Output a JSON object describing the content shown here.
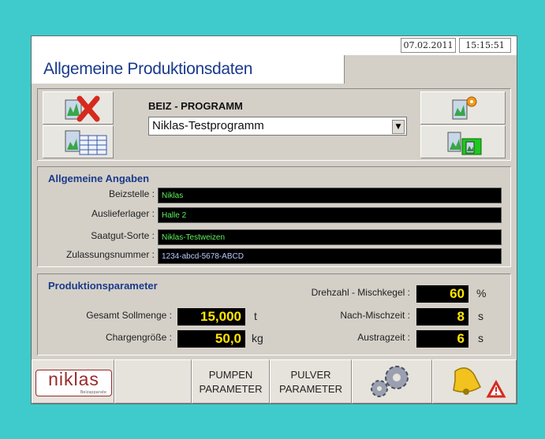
{
  "header": {
    "date": "07.02.2011",
    "time": "15:15:51"
  },
  "title": "Allgemeine Produktionsdaten",
  "program": {
    "label": "BEIZ - PROGRAMM",
    "selected": "Niklas-Testprogramm"
  },
  "general": {
    "title": "Allgemeine Angaben",
    "rows": [
      {
        "label": "Beizstelle :",
        "value": "Niklas"
      },
      {
        "label": "Auslieferlager :",
        "value": "Halle 2"
      },
      {
        "label": "Saatgut-Sorte :",
        "value": "Niklas-Testweizen"
      },
      {
        "label": "Zulassungsnummer :",
        "value": "1234-abcd-5678-ABCD"
      }
    ]
  },
  "params": {
    "title": "Produktionsparameter",
    "gesamt": {
      "label": "Gesamt Sollmenge :",
      "value": "15,000",
      "unit": "t"
    },
    "charge": {
      "label": "Chargengröße :",
      "value": "50,0",
      "unit": "kg"
    },
    "drehzahl": {
      "label": "Drehzahl - Mischkegel :",
      "value": "60",
      "unit": "%"
    },
    "nachmisch": {
      "label": "Nach-Mischzeit :",
      "value": "8",
      "unit": "s"
    },
    "austrag": {
      "label": "Austragzeit :",
      "value": "6",
      "unit": "s"
    }
  },
  "bottom": {
    "logo": "niklas",
    "logo_sub": "Beizapparate",
    "pumpen_1": "PUMPEN",
    "pumpen_2": "PARAMETER",
    "pulver_1": "PULVER",
    "pulver_2": "PARAMETER"
  },
  "colors": {
    "title": "#1a3a8a",
    "field_text": "#5df05d",
    "number_text": "#ffe600",
    "background": "#3fcbcb"
  }
}
